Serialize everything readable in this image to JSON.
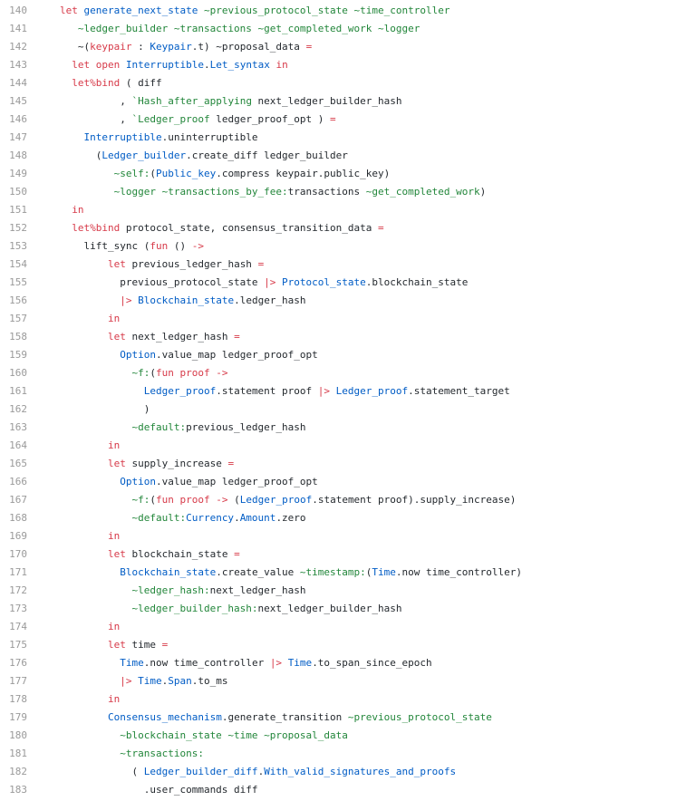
{
  "theme": {
    "keyword": "#d73a49",
    "label": "#22863a",
    "module": "#005cc5",
    "plain": "#24292e",
    "line_number": "#9a9a9a",
    "background": "#ffffff"
  },
  "lines": [
    {
      "num": "140",
      "tokens": [
        [
          "let",
          "kw"
        ],
        [
          " ",
          "p"
        ],
        [
          "generate_next_state",
          "mod"
        ],
        [
          " ~previous_protocol_state ~time_controller",
          "lbl"
        ]
      ]
    },
    {
      "num": "141",
      "tokens": [
        [
          "   ~ledger_builder ~transactions ~get_completed_work ~logger",
          "lbl"
        ]
      ]
    },
    {
      "num": "142",
      "tokens": [
        [
          "   ~(",
          "p"
        ],
        [
          "keypair",
          "kw"
        ],
        [
          " : ",
          "p"
        ],
        [
          "Keypair",
          "mod"
        ],
        [
          ".t) ~proposal_data ",
          "p"
        ],
        [
          "=",
          "kw"
        ]
      ]
    },
    {
      "num": "143",
      "tokens": [
        [
          "  ",
          "p"
        ],
        [
          "let",
          "kw"
        ],
        [
          " ",
          "p"
        ],
        [
          "open",
          "kw"
        ],
        [
          " ",
          "p"
        ],
        [
          "Interruptible",
          "mod"
        ],
        [
          ".",
          "p"
        ],
        [
          "Let_syntax",
          "mod"
        ],
        [
          " ",
          "p"
        ],
        [
          "in",
          "kw"
        ]
      ]
    },
    {
      "num": "144",
      "tokens": [
        [
          "  ",
          "p"
        ],
        [
          "let%bind",
          "kw"
        ],
        [
          " ( diff",
          "p"
        ]
      ]
    },
    {
      "num": "145",
      "tokens": [
        [
          "          , ",
          "p"
        ],
        [
          "`Hash_after_applying",
          "lbl"
        ],
        [
          " next_ledger_builder_hash",
          "p"
        ]
      ]
    },
    {
      "num": "146",
      "tokens": [
        [
          "          , ",
          "p"
        ],
        [
          "`Ledger_proof",
          "lbl"
        ],
        [
          " ledger_proof_opt ) ",
          "p"
        ],
        [
          "=",
          "kw"
        ]
      ]
    },
    {
      "num": "147",
      "tokens": [
        [
          "    ",
          "p"
        ],
        [
          "Interruptible",
          "mod"
        ],
        [
          ".uninterruptible",
          "p"
        ]
      ]
    },
    {
      "num": "148",
      "tokens": [
        [
          "      (",
          "p"
        ],
        [
          "Ledger_builder",
          "mod"
        ],
        [
          ".create_diff ledger_builder",
          "p"
        ]
      ]
    },
    {
      "num": "149",
      "tokens": [
        [
          "         ~self:",
          "lbl"
        ],
        [
          "(",
          "p"
        ],
        [
          "Public_key",
          "mod"
        ],
        [
          ".compress keypair.public_key)",
          "p"
        ]
      ]
    },
    {
      "num": "150",
      "tokens": [
        [
          "         ~logger ~transactions_by_fee:",
          "lbl"
        ],
        [
          "transactions ",
          "p"
        ],
        [
          "~get_completed_work",
          "lbl"
        ],
        [
          ")",
          "p"
        ]
      ]
    },
    {
      "num": "151",
      "tokens": [
        [
          "  ",
          "p"
        ],
        [
          "in",
          "kw"
        ]
      ]
    },
    {
      "num": "152",
      "tokens": [
        [
          "  ",
          "p"
        ],
        [
          "let%bind",
          "kw"
        ],
        [
          " protocol_state, consensus_transition_data ",
          "p"
        ],
        [
          "=",
          "kw"
        ]
      ]
    },
    {
      "num": "153",
      "tokens": [
        [
          "    lift_sync (",
          "p"
        ],
        [
          "fun",
          "kw"
        ],
        [
          " () ",
          "p"
        ],
        [
          "->",
          "kw"
        ]
      ]
    },
    {
      "num": "154",
      "tokens": [
        [
          "        ",
          "p"
        ],
        [
          "let",
          "kw"
        ],
        [
          " previous_ledger_hash ",
          "p"
        ],
        [
          "=",
          "kw"
        ]
      ]
    },
    {
      "num": "155",
      "tokens": [
        [
          "          previous_protocol_state ",
          "p"
        ],
        [
          "|>",
          "kw"
        ],
        [
          " ",
          "p"
        ],
        [
          "Protocol_state",
          "mod"
        ],
        [
          ".blockchain_state",
          "p"
        ]
      ]
    },
    {
      "num": "156",
      "tokens": [
        [
          "          ",
          "p"
        ],
        [
          "|>",
          "kw"
        ],
        [
          " ",
          "p"
        ],
        [
          "Blockchain_state",
          "mod"
        ],
        [
          ".ledger_hash",
          "p"
        ]
      ]
    },
    {
      "num": "157",
      "tokens": [
        [
          "        ",
          "p"
        ],
        [
          "in",
          "kw"
        ]
      ]
    },
    {
      "num": "158",
      "tokens": [
        [
          "        ",
          "p"
        ],
        [
          "let",
          "kw"
        ],
        [
          " next_ledger_hash ",
          "p"
        ],
        [
          "=",
          "kw"
        ]
      ]
    },
    {
      "num": "159",
      "tokens": [
        [
          "          ",
          "p"
        ],
        [
          "Option",
          "mod"
        ],
        [
          ".value_map ledger_proof_opt",
          "p"
        ]
      ]
    },
    {
      "num": "160",
      "tokens": [
        [
          "            ~f:",
          "lbl"
        ],
        [
          "(",
          "p"
        ],
        [
          "fun",
          "kw"
        ],
        [
          " ",
          "p"
        ],
        [
          "proof",
          "kw"
        ],
        [
          " ",
          "p"
        ],
        [
          "->",
          "kw"
        ]
      ]
    },
    {
      "num": "161",
      "tokens": [
        [
          "              ",
          "p"
        ],
        [
          "Ledger_proof",
          "mod"
        ],
        [
          ".statement proof ",
          "p"
        ],
        [
          "|>",
          "kw"
        ],
        [
          " ",
          "p"
        ],
        [
          "Ledger_proof",
          "mod"
        ],
        [
          ".statement_target",
          "p"
        ]
      ]
    },
    {
      "num": "162",
      "tokens": [
        [
          "              )",
          "p"
        ]
      ]
    },
    {
      "num": "163",
      "tokens": [
        [
          "            ~default:",
          "lbl"
        ],
        [
          "previous_ledger_hash",
          "p"
        ]
      ]
    },
    {
      "num": "164",
      "tokens": [
        [
          "        ",
          "p"
        ],
        [
          "in",
          "kw"
        ]
      ]
    },
    {
      "num": "165",
      "tokens": [
        [
          "        ",
          "p"
        ],
        [
          "let",
          "kw"
        ],
        [
          " supply_increase ",
          "p"
        ],
        [
          "=",
          "kw"
        ]
      ]
    },
    {
      "num": "166",
      "tokens": [
        [
          "          ",
          "p"
        ],
        [
          "Option",
          "mod"
        ],
        [
          ".value_map ledger_proof_opt",
          "p"
        ]
      ]
    },
    {
      "num": "167",
      "tokens": [
        [
          "            ~f:",
          "lbl"
        ],
        [
          "(",
          "p"
        ],
        [
          "fun",
          "kw"
        ],
        [
          " ",
          "p"
        ],
        [
          "proof",
          "kw"
        ],
        [
          " ",
          "p"
        ],
        [
          "->",
          "kw"
        ],
        [
          " (",
          "p"
        ],
        [
          "Ledger_proof",
          "mod"
        ],
        [
          ".statement proof).supply_increase)",
          "p"
        ]
      ]
    },
    {
      "num": "168",
      "tokens": [
        [
          "            ~default:",
          "lbl"
        ],
        [
          "Currency",
          "mod"
        ],
        [
          ".",
          "p"
        ],
        [
          "Amount",
          "mod"
        ],
        [
          ".zero",
          "p"
        ]
      ]
    },
    {
      "num": "169",
      "tokens": [
        [
          "        ",
          "p"
        ],
        [
          "in",
          "kw"
        ]
      ]
    },
    {
      "num": "170",
      "tokens": [
        [
          "        ",
          "p"
        ],
        [
          "let",
          "kw"
        ],
        [
          " blockchain_state ",
          "p"
        ],
        [
          "=",
          "kw"
        ]
      ]
    },
    {
      "num": "171",
      "tokens": [
        [
          "          ",
          "p"
        ],
        [
          "Blockchain_state",
          "mod"
        ],
        [
          ".create_value ",
          "p"
        ],
        [
          "~timestamp:",
          "lbl"
        ],
        [
          "(",
          "p"
        ],
        [
          "Time",
          "mod"
        ],
        [
          ".now time_controller)",
          "p"
        ]
      ]
    },
    {
      "num": "172",
      "tokens": [
        [
          "            ~ledger_hash:",
          "lbl"
        ],
        [
          "next_ledger_hash",
          "p"
        ]
      ]
    },
    {
      "num": "173",
      "tokens": [
        [
          "            ~ledger_builder_hash:",
          "lbl"
        ],
        [
          "next_ledger_builder_hash",
          "p"
        ]
      ]
    },
    {
      "num": "174",
      "tokens": [
        [
          "        ",
          "p"
        ],
        [
          "in",
          "kw"
        ]
      ]
    },
    {
      "num": "175",
      "tokens": [
        [
          "        ",
          "p"
        ],
        [
          "let",
          "kw"
        ],
        [
          " time ",
          "p"
        ],
        [
          "=",
          "kw"
        ]
      ]
    },
    {
      "num": "176",
      "tokens": [
        [
          "          ",
          "p"
        ],
        [
          "Time",
          "mod"
        ],
        [
          ".now time_controller ",
          "p"
        ],
        [
          "|>",
          "kw"
        ],
        [
          " ",
          "p"
        ],
        [
          "Time",
          "mod"
        ],
        [
          ".to_span_since_epoch",
          "p"
        ]
      ]
    },
    {
      "num": "177",
      "tokens": [
        [
          "          ",
          "p"
        ],
        [
          "|>",
          "kw"
        ],
        [
          " ",
          "p"
        ],
        [
          "Time",
          "mod"
        ],
        [
          ".",
          "p"
        ],
        [
          "Span",
          "mod"
        ],
        [
          ".to_ms",
          "p"
        ]
      ]
    },
    {
      "num": "178",
      "tokens": [
        [
          "        ",
          "p"
        ],
        [
          "in",
          "kw"
        ]
      ]
    },
    {
      "num": "179",
      "tokens": [
        [
          "        ",
          "p"
        ],
        [
          "Consensus_mechanism",
          "mod"
        ],
        [
          ".generate_transition ",
          "p"
        ],
        [
          "~previous_protocol_state",
          "lbl"
        ]
      ]
    },
    {
      "num": "180",
      "tokens": [
        [
          "          ~blockchain_state ~time ~proposal_data",
          "lbl"
        ]
      ]
    },
    {
      "num": "181",
      "tokens": [
        [
          "          ~transactions:",
          "lbl"
        ]
      ]
    },
    {
      "num": "182",
      "tokens": [
        [
          "            ( ",
          "p"
        ],
        [
          "Ledger_builder_diff",
          "mod"
        ],
        [
          ".",
          "p"
        ],
        [
          "With_valid_signatures_and_proofs",
          "mod"
        ]
      ]
    },
    {
      "num": "183",
      "tokens": [
        [
          "              .user_commands diff",
          "p"
        ]
      ]
    }
  ]
}
